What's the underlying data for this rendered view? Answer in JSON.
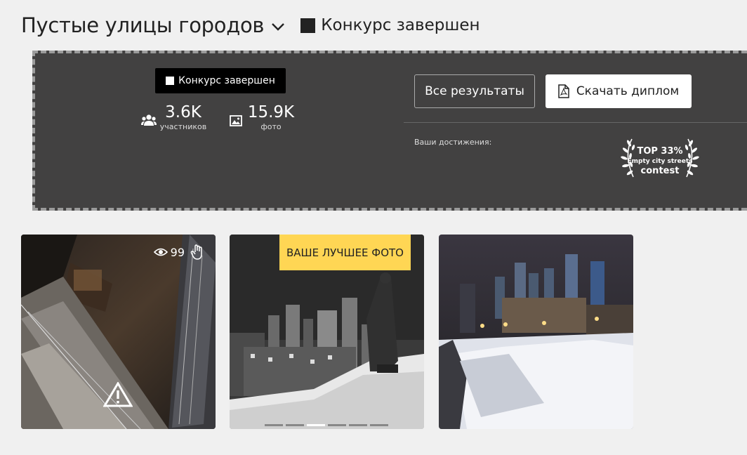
{
  "header": {
    "title": "Пустые улицы городов",
    "status": "Конкурс завершен"
  },
  "panel": {
    "badge": "Конкурс завершен",
    "stats": [
      {
        "value": "3.6K",
        "label": "участников",
        "icon": "users-icon"
      },
      {
        "value": "15.9K",
        "label": "фото",
        "icon": "image-icon"
      }
    ],
    "all_results_label": "Все результаты",
    "download_label": "Скачать диплом",
    "achievements_label": "Ваши достижения:",
    "achievement": {
      "top": "TOP 33%",
      "line1": "Empty city streets",
      "line2": "contest"
    }
  },
  "photos": [
    {
      "views": "99",
      "warning": true
    },
    {
      "ribbon": "ВАШЕ ЛУЧШЕЕ ФОТО",
      "slide_count": 6,
      "active_slide": 3
    },
    {}
  ],
  "colors": {
    "panel_bg": "#424141",
    "ribbon": "#ffd654"
  }
}
